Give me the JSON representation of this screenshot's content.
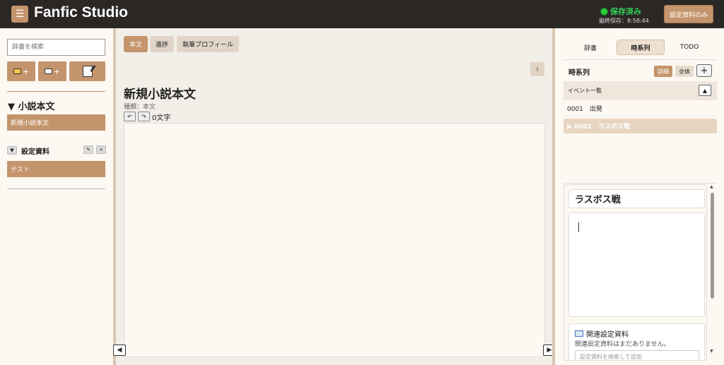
{
  "header": {
    "menu_icon": "☰",
    "title": "Fanfic Studio",
    "save_status": "保存済み",
    "last_saved": "最終保存：8:58:44",
    "settings_only_button": "設定資料のみ"
  },
  "left_sidebar": {
    "search_placeholder": "辞書を検索",
    "add_symbol": "+",
    "novel_heading": "▼ 小説本文",
    "novel_item": "新規小説本文",
    "settings_toggle": "▼",
    "settings_label": "設定資料",
    "edit_icon": "✎",
    "close_icon": "×",
    "settings_item": "テスト"
  },
  "center": {
    "tabs": [
      {
        "label": "本文",
        "active": true
      },
      {
        "label": "進捗",
        "active": false
      },
      {
        "label": "執筆プロフィール",
        "active": false
      }
    ],
    "pause_icon": "Ⅱ",
    "doc_title": "新規小説本文",
    "doc_type": "種類：本文",
    "undo_icon": "↶",
    "redo_icon": "↷",
    "char_count": "0文字",
    "collapse_left": "◀",
    "collapse_right": "▶"
  },
  "right_sidebar": {
    "tabs": [
      {
        "label": "辞書",
        "active": false
      },
      {
        "label": "時系列",
        "active": true
      },
      {
        "label": "TODO",
        "active": false
      }
    ],
    "timeline_label": "時系列",
    "detail_button": "詳細",
    "all_button": "全体",
    "add_button": "+",
    "event_list_header": "イベント一覧",
    "up_icon": "▲",
    "events": [
      {
        "label": "0001　出発",
        "active": false
      },
      {
        "label": "▶ 0002　ラスボス戦",
        "active": true
      }
    ],
    "detail": {
      "title": "ラスボス戦",
      "related_title": "関連設定資料",
      "related_empty": "関連設定資料はまだありません。",
      "related_search_placeholder": "設定資料を検索して追加"
    },
    "scroll_up": "▲",
    "scroll_down": "▼"
  },
  "colors": {
    "header_bg": "#2b2725",
    "accent": "#c4956c",
    "panel_bg": "#fdf8f2",
    "saved_green": "#34d058"
  }
}
